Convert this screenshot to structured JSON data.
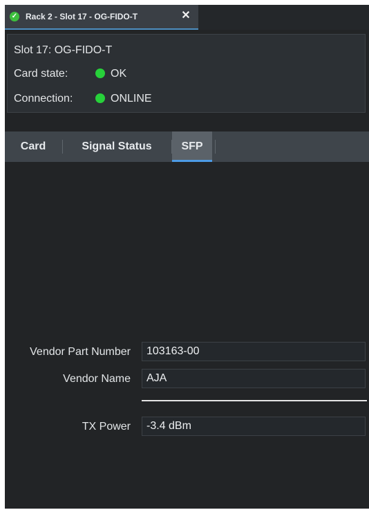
{
  "tab": {
    "title": "Rack 2 - Slot 17 - OG-FIDO-T",
    "close_glyph": "✕",
    "status_glyph": "✓"
  },
  "info": {
    "title": "Slot 17: OG-FIDO-T",
    "card_state_label": "Card state:",
    "card_state_value": "OK",
    "connection_label": "Connection:",
    "connection_value": "ONLINE",
    "status_color": "#27d13a"
  },
  "tabs": [
    {
      "label": "Card",
      "selected": false
    },
    {
      "label": "Signal Status",
      "selected": false
    },
    {
      "label": "SFP",
      "selected": true
    }
  ],
  "sfp": {
    "vendor_part_number_label": "Vendor Part Number",
    "vendor_part_number": "103163-00",
    "vendor_name_label": "Vendor Name",
    "vendor_name": "AJA",
    "tx_power_label": "TX Power",
    "tx_power": "-3.4 dBm"
  },
  "colors": {
    "accent": "#4d9be6",
    "background": "#222426"
  }
}
